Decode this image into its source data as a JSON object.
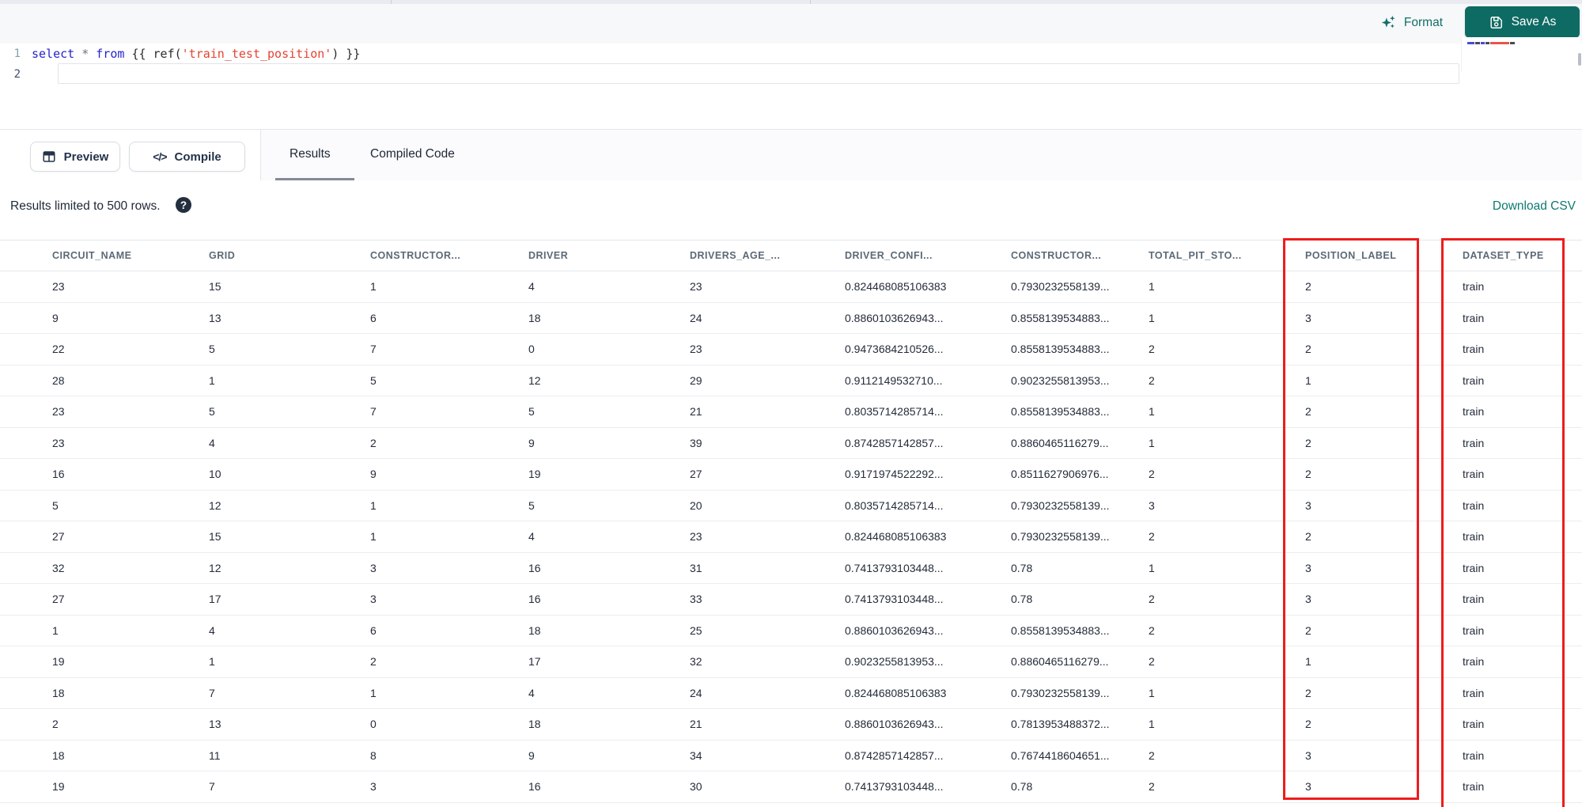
{
  "topbar": {
    "format_label": "Format",
    "save_as_label": "Save As"
  },
  "editor": {
    "lines": [
      {
        "number": "1",
        "tokens": [
          {
            "text": "select",
            "type": "kw"
          },
          {
            "text": " ",
            "type": "br"
          },
          {
            "text": "*",
            "type": "op"
          },
          {
            "text": " ",
            "type": "br"
          },
          {
            "text": "from",
            "type": "kw"
          },
          {
            "text": " ",
            "type": "br"
          },
          {
            "text": "{{ ",
            "type": "br"
          },
          {
            "text": "ref(",
            "type": "fn"
          },
          {
            "text": "'train_test_position'",
            "type": "str"
          },
          {
            "text": ")",
            "type": "fn"
          },
          {
            "text": " }}",
            "type": "br"
          }
        ]
      },
      {
        "number": "2",
        "tokens": []
      }
    ]
  },
  "toolbar": {
    "preview_label": "Preview",
    "compile_label": "Compile",
    "tabs": [
      {
        "label": "Results",
        "active": true
      },
      {
        "label": "Compiled Code",
        "active": false
      }
    ]
  },
  "results_bar": {
    "limit_text": "Results limited to 500 rows.",
    "help_glyph": "?",
    "download_label": "Download CSV"
  },
  "table": {
    "columns": [
      "CIRCUIT_NAME",
      "GRID",
      "CONSTRUCTOR...",
      "DRIVER",
      "DRIVERS_AGE_...",
      "DRIVER_CONFI...",
      "CONSTRUCTOR...",
      "TOTAL_PIT_STO...",
      "POSITION_LABEL",
      "DATASET_TYPE"
    ],
    "highlighted_columns": [
      "POSITION_LABEL",
      "DATASET_TYPE"
    ],
    "rows": [
      [
        "23",
        "15",
        "1",
        "4",
        "23",
        "0.824468085106383",
        "0.7930232558139...",
        "1",
        "2",
        "train"
      ],
      [
        "9",
        "13",
        "6",
        "18",
        "24",
        "0.8860103626943...",
        "0.8558139534883...",
        "1",
        "3",
        "train"
      ],
      [
        "22",
        "5",
        "7",
        "0",
        "23",
        "0.9473684210526...",
        "0.8558139534883...",
        "2",
        "2",
        "train"
      ],
      [
        "28",
        "1",
        "5",
        "12",
        "29",
        "0.9112149532710...",
        "0.9023255813953...",
        "2",
        "1",
        "train"
      ],
      [
        "23",
        "5",
        "7",
        "5",
        "21",
        "0.8035714285714...",
        "0.8558139534883...",
        "1",
        "2",
        "train"
      ],
      [
        "23",
        "4",
        "2",
        "9",
        "39",
        "0.8742857142857...",
        "0.8860465116279...",
        "1",
        "2",
        "train"
      ],
      [
        "16",
        "10",
        "9",
        "19",
        "27",
        "0.9171974522292...",
        "0.8511627906976...",
        "2",
        "2",
        "train"
      ],
      [
        "5",
        "12",
        "1",
        "5",
        "20",
        "0.8035714285714...",
        "0.7930232558139...",
        "3",
        "3",
        "train"
      ],
      [
        "27",
        "15",
        "1",
        "4",
        "23",
        "0.824468085106383",
        "0.7930232558139...",
        "2",
        "2",
        "train"
      ],
      [
        "32",
        "12",
        "3",
        "16",
        "31",
        "0.7413793103448...",
        "0.78",
        "1",
        "3",
        "train"
      ],
      [
        "27",
        "17",
        "3",
        "16",
        "33",
        "0.7413793103448...",
        "0.78",
        "2",
        "3",
        "train"
      ],
      [
        "1",
        "4",
        "6",
        "18",
        "25",
        "0.8860103626943...",
        "0.8558139534883...",
        "2",
        "2",
        "train"
      ],
      [
        "19",
        "1",
        "2",
        "17",
        "32",
        "0.9023255813953...",
        "0.8860465116279...",
        "2",
        "1",
        "train"
      ],
      [
        "18",
        "7",
        "1",
        "4",
        "24",
        "0.824468085106383",
        "0.7930232558139...",
        "1",
        "2",
        "train"
      ],
      [
        "2",
        "13",
        "0",
        "18",
        "21",
        "0.8860103626943...",
        "0.7813953488372...",
        "1",
        "2",
        "train"
      ],
      [
        "18",
        "11",
        "8",
        "9",
        "34",
        "0.8742857142857...",
        "0.7674418604651...",
        "2",
        "3",
        "train"
      ],
      [
        "19",
        "7",
        "3",
        "16",
        "30",
        "0.7413793103448...",
        "0.78",
        "2",
        "3",
        "train"
      ]
    ]
  },
  "colors": {
    "accent_teal": "#0e6b63",
    "link_teal": "#0c7a72",
    "annotation_red": "#ee1c1c"
  }
}
